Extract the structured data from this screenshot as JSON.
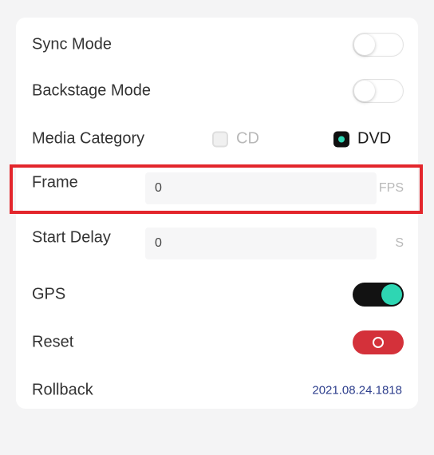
{
  "settings": {
    "sync_mode": {
      "label": "Sync Mode",
      "enabled": false
    },
    "backstage_mode": {
      "label": "Backstage Mode",
      "enabled": false
    },
    "media_category": {
      "label": "Media Category",
      "options": [
        "CD",
        "DVD"
      ],
      "selected": "DVD"
    },
    "frame": {
      "label": "Frame",
      "value": "0",
      "unit": "FPS"
    },
    "start_delay": {
      "label": "Start Delay",
      "value": "0",
      "unit": "S"
    },
    "gps": {
      "label": "GPS",
      "enabled": true
    },
    "reset": {
      "label": "Reset"
    },
    "rollback": {
      "label": "Rollback",
      "version": "2021.08.24.1818"
    }
  },
  "colors": {
    "toggle_on_track": "#121212",
    "toggle_on_knob": "#2ed6b3",
    "reset_button": "#d4313a",
    "highlight_border": "#e3262c",
    "version_text": "#2d3e8c"
  }
}
